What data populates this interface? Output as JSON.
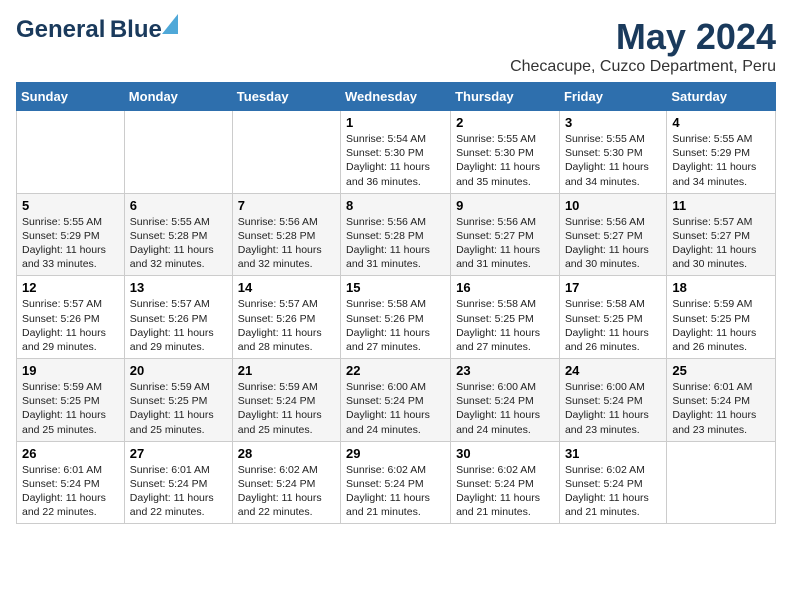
{
  "header": {
    "logo_line1": "General",
    "logo_line2": "Blue",
    "month": "May 2024",
    "location": "Checacupe, Cuzco Department, Peru"
  },
  "weekdays": [
    "Sunday",
    "Monday",
    "Tuesday",
    "Wednesday",
    "Thursday",
    "Friday",
    "Saturday"
  ],
  "weeks": [
    [
      {
        "day": "",
        "info": ""
      },
      {
        "day": "",
        "info": ""
      },
      {
        "day": "",
        "info": ""
      },
      {
        "day": "1",
        "info": "Sunrise: 5:54 AM\nSunset: 5:30 PM\nDaylight: 11 hours\nand 36 minutes."
      },
      {
        "day": "2",
        "info": "Sunrise: 5:55 AM\nSunset: 5:30 PM\nDaylight: 11 hours\nand 35 minutes."
      },
      {
        "day": "3",
        "info": "Sunrise: 5:55 AM\nSunset: 5:30 PM\nDaylight: 11 hours\nand 34 minutes."
      },
      {
        "day": "4",
        "info": "Sunrise: 5:55 AM\nSunset: 5:29 PM\nDaylight: 11 hours\nand 34 minutes."
      }
    ],
    [
      {
        "day": "5",
        "info": "Sunrise: 5:55 AM\nSunset: 5:29 PM\nDaylight: 11 hours\nand 33 minutes."
      },
      {
        "day": "6",
        "info": "Sunrise: 5:55 AM\nSunset: 5:28 PM\nDaylight: 11 hours\nand 32 minutes."
      },
      {
        "day": "7",
        "info": "Sunrise: 5:56 AM\nSunset: 5:28 PM\nDaylight: 11 hours\nand 32 minutes."
      },
      {
        "day": "8",
        "info": "Sunrise: 5:56 AM\nSunset: 5:28 PM\nDaylight: 11 hours\nand 31 minutes."
      },
      {
        "day": "9",
        "info": "Sunrise: 5:56 AM\nSunset: 5:27 PM\nDaylight: 11 hours\nand 31 minutes."
      },
      {
        "day": "10",
        "info": "Sunrise: 5:56 AM\nSunset: 5:27 PM\nDaylight: 11 hours\nand 30 minutes."
      },
      {
        "day": "11",
        "info": "Sunrise: 5:57 AM\nSunset: 5:27 PM\nDaylight: 11 hours\nand 30 minutes."
      }
    ],
    [
      {
        "day": "12",
        "info": "Sunrise: 5:57 AM\nSunset: 5:26 PM\nDaylight: 11 hours\nand 29 minutes."
      },
      {
        "day": "13",
        "info": "Sunrise: 5:57 AM\nSunset: 5:26 PM\nDaylight: 11 hours\nand 29 minutes."
      },
      {
        "day": "14",
        "info": "Sunrise: 5:57 AM\nSunset: 5:26 PM\nDaylight: 11 hours\nand 28 minutes."
      },
      {
        "day": "15",
        "info": "Sunrise: 5:58 AM\nSunset: 5:26 PM\nDaylight: 11 hours\nand 27 minutes."
      },
      {
        "day": "16",
        "info": "Sunrise: 5:58 AM\nSunset: 5:25 PM\nDaylight: 11 hours\nand 27 minutes."
      },
      {
        "day": "17",
        "info": "Sunrise: 5:58 AM\nSunset: 5:25 PM\nDaylight: 11 hours\nand 26 minutes."
      },
      {
        "day": "18",
        "info": "Sunrise: 5:59 AM\nSunset: 5:25 PM\nDaylight: 11 hours\nand 26 minutes."
      }
    ],
    [
      {
        "day": "19",
        "info": "Sunrise: 5:59 AM\nSunset: 5:25 PM\nDaylight: 11 hours\nand 25 minutes."
      },
      {
        "day": "20",
        "info": "Sunrise: 5:59 AM\nSunset: 5:25 PM\nDaylight: 11 hours\nand 25 minutes."
      },
      {
        "day": "21",
        "info": "Sunrise: 5:59 AM\nSunset: 5:24 PM\nDaylight: 11 hours\nand 25 minutes."
      },
      {
        "day": "22",
        "info": "Sunrise: 6:00 AM\nSunset: 5:24 PM\nDaylight: 11 hours\nand 24 minutes."
      },
      {
        "day": "23",
        "info": "Sunrise: 6:00 AM\nSunset: 5:24 PM\nDaylight: 11 hours\nand 24 minutes."
      },
      {
        "day": "24",
        "info": "Sunrise: 6:00 AM\nSunset: 5:24 PM\nDaylight: 11 hours\nand 23 minutes."
      },
      {
        "day": "25",
        "info": "Sunrise: 6:01 AM\nSunset: 5:24 PM\nDaylight: 11 hours\nand 23 minutes."
      }
    ],
    [
      {
        "day": "26",
        "info": "Sunrise: 6:01 AM\nSunset: 5:24 PM\nDaylight: 11 hours\nand 22 minutes."
      },
      {
        "day": "27",
        "info": "Sunrise: 6:01 AM\nSunset: 5:24 PM\nDaylight: 11 hours\nand 22 minutes."
      },
      {
        "day": "28",
        "info": "Sunrise: 6:02 AM\nSunset: 5:24 PM\nDaylight: 11 hours\nand 22 minutes."
      },
      {
        "day": "29",
        "info": "Sunrise: 6:02 AM\nSunset: 5:24 PM\nDaylight: 11 hours\nand 21 minutes."
      },
      {
        "day": "30",
        "info": "Sunrise: 6:02 AM\nSunset: 5:24 PM\nDaylight: 11 hours\nand 21 minutes."
      },
      {
        "day": "31",
        "info": "Sunrise: 6:02 AM\nSunset: 5:24 PM\nDaylight: 11 hours\nand 21 minutes."
      },
      {
        "day": "",
        "info": ""
      }
    ]
  ]
}
